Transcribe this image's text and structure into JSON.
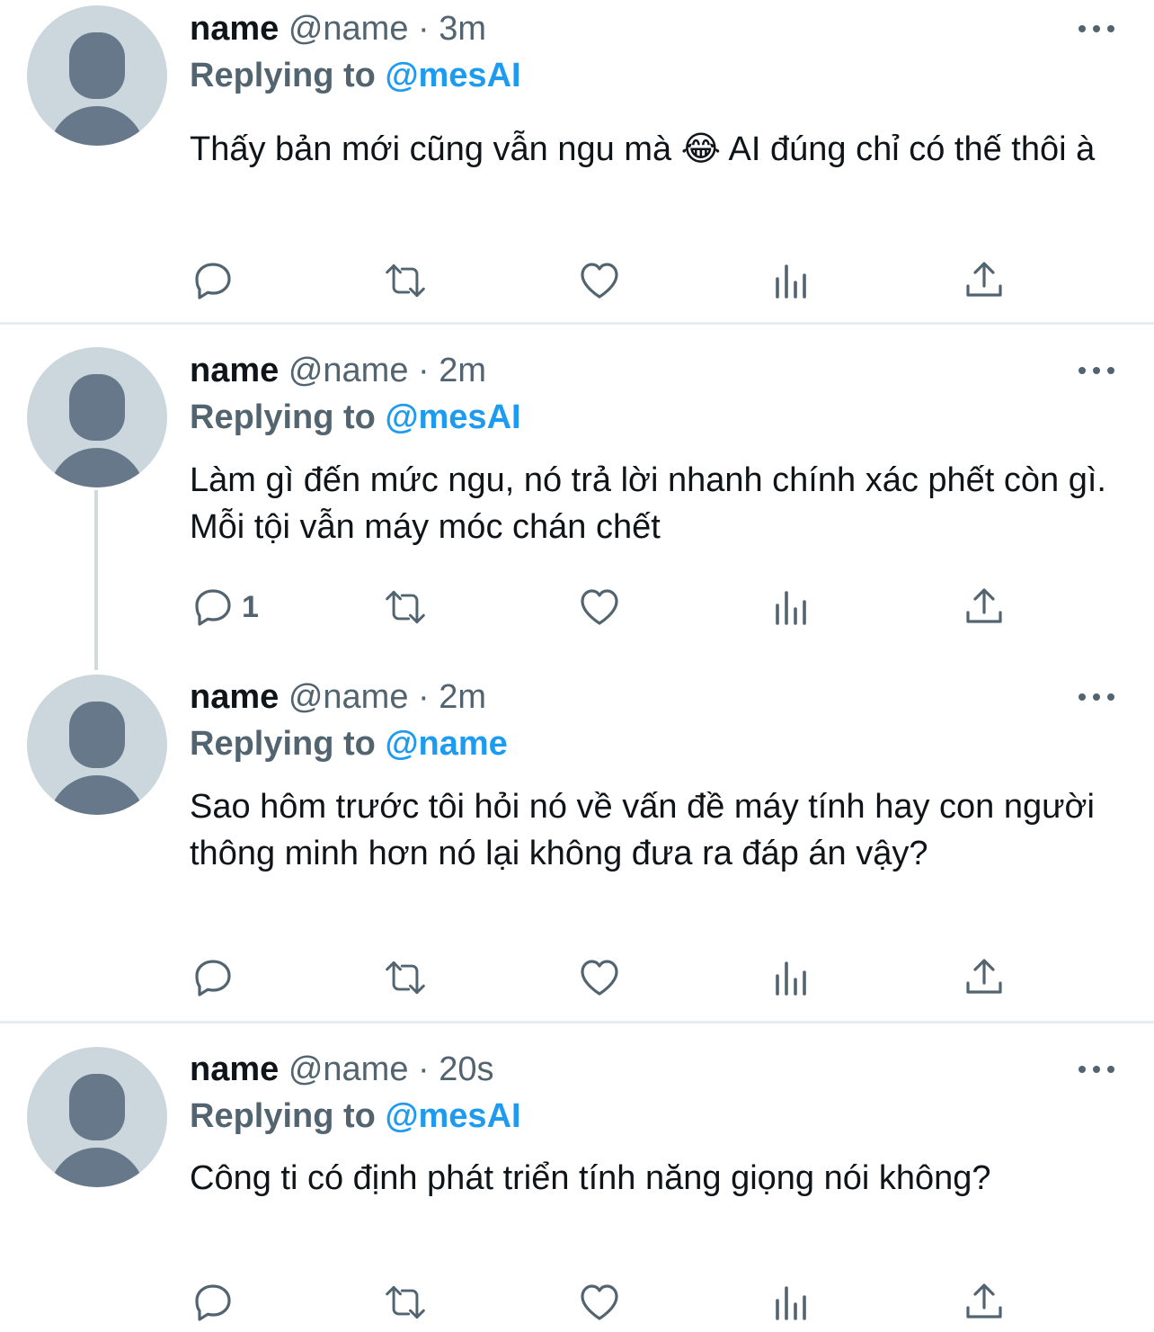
{
  "tweets": [
    {
      "name": "name",
      "meta": "@name · 3m",
      "replying_prefix": "Replying to",
      "replying_to": "@mesAI",
      "text": "Thấy bản mới cũng vẫn ngu mà 😂  AI đúng chỉ có thế thôi à",
      "reply_count": ""
    },
    {
      "name": "name",
      "meta": "@name · 2m",
      "replying_prefix": "Replying to",
      "replying_to": "@mesAI",
      "text": "Làm gì đến mức ngu, nó trả lời nhanh chính xác phết còn gì. Mỗi tội vẫn máy móc chán chết",
      "reply_count": "1"
    },
    {
      "name": "name",
      "meta": "@name · 2m",
      "replying_prefix": "Replying to",
      "replying_to": "@name",
      "text": "Sao hôm trước tôi hỏi nó về vấn đề máy tính hay con người thông minh hơn nó lại không đưa ra đáp án vậy?",
      "reply_count": ""
    },
    {
      "name": "name",
      "meta": "@name · 20s",
      "replying_prefix": "Replying to",
      "replying_to": "@mesAI",
      "text": "Công ti có định phát triển tính năng giọng nói không?",
      "reply_count": ""
    }
  ],
  "icons": {
    "reply": "reply-icon",
    "retweet": "retweet-icon",
    "like": "heart-icon",
    "views": "views-icon",
    "share": "share-icon",
    "more": "more-icon"
  },
  "colors": {
    "accent": "#1d9bf0",
    "secondary_text": "#536471",
    "avatar_bg": "#ccd6dd",
    "avatar_fg": "#66788a"
  }
}
